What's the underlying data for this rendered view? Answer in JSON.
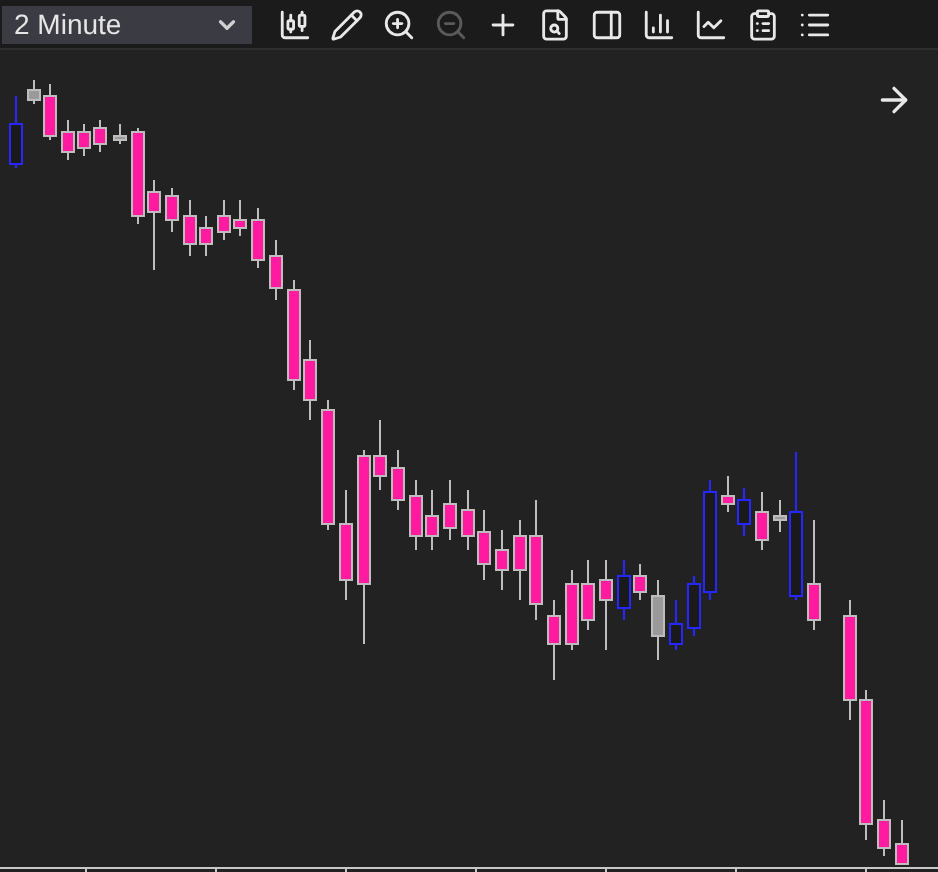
{
  "interval_select": {
    "value": "2 Minute"
  },
  "tools": [
    {
      "kind": "candles",
      "disabled": false
    },
    {
      "kind": "draw",
      "disabled": false
    },
    {
      "kind": "zoom_in",
      "disabled": false
    },
    {
      "kind": "zoom_out",
      "disabled": true
    },
    {
      "kind": "crosshair",
      "disabled": false
    },
    {
      "kind": "inspect",
      "disabled": false
    },
    {
      "kind": "panel",
      "disabled": false
    },
    {
      "kind": "bars",
      "disabled": false
    },
    {
      "kind": "line",
      "disabled": false
    },
    {
      "kind": "report",
      "disabled": false
    },
    {
      "kind": "list",
      "disabled": false
    }
  ]
}
